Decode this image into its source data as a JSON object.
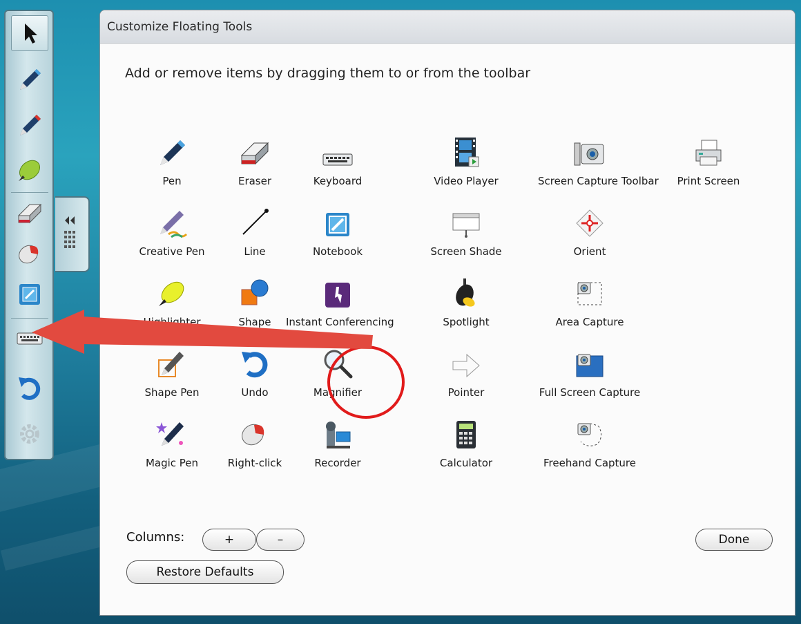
{
  "dialog": {
    "title": "Customize Floating Tools",
    "instructions": "Add or remove items by dragging them to or from the toolbar",
    "columns_label": "Columns:",
    "plus_label": "+",
    "minus_label": "–",
    "restore_label": "Restore Defaults",
    "done_label": "Done"
  },
  "tools": [
    {
      "label": "Pen",
      "icon": "pen-icon"
    },
    {
      "label": "Eraser",
      "icon": "eraser-icon"
    },
    {
      "label": "Keyboard",
      "icon": "keyboard-icon"
    },
    {
      "label": "Video Player",
      "icon": "video-player-icon"
    },
    {
      "label": "Screen Capture Toolbar",
      "icon": "screen-capture-icon"
    },
    {
      "label": "Print Screen",
      "icon": "printer-icon"
    },
    {
      "label": "Creative Pen",
      "icon": "creative-pen-icon"
    },
    {
      "label": "Line",
      "icon": "line-icon"
    },
    {
      "label": "Notebook",
      "icon": "notebook-icon"
    },
    {
      "label": "Screen Shade",
      "icon": "screen-shade-icon"
    },
    {
      "label": "Orient",
      "icon": "orient-icon"
    },
    {
      "label": "Highlighter",
      "icon": "highlighter-icon"
    },
    {
      "label": "Shape",
      "icon": "shape-icon"
    },
    {
      "label": "Instant Conferencing",
      "icon": "conferencing-icon"
    },
    {
      "label": "Spotlight",
      "icon": "spotlight-icon"
    },
    {
      "label": "Area Capture",
      "icon": "area-capture-icon"
    },
    {
      "label": "Shape Pen",
      "icon": "shape-pen-icon"
    },
    {
      "label": "Undo",
      "icon": "undo-icon"
    },
    {
      "label": "Magnifier",
      "icon": "magnifier-icon"
    },
    {
      "label": "Pointer",
      "icon": "pointer-arrow-icon"
    },
    {
      "label": "Full Screen Capture",
      "icon": "full-screen-capture-icon"
    },
    {
      "label": "Magic Pen",
      "icon": "magic-pen-icon"
    },
    {
      "label": "Right-click",
      "icon": "right-click-icon"
    },
    {
      "label": "Recorder",
      "icon": "recorder-icon"
    },
    {
      "label": "Calculator",
      "icon": "calculator-icon"
    },
    {
      "label": "Freehand Capture",
      "icon": "freehand-capture-icon"
    }
  ],
  "toolbar": {
    "items": [
      "select-icon",
      "pen-icon",
      "pen-icon",
      "highlighter-icon",
      "eraser-icon",
      "right-click-icon",
      "notebook-icon",
      "keyboard-icon",
      "undo-icon",
      "settings-gear-icon"
    ],
    "collapse_icon": "collapse-arrows-icon"
  },
  "annotation": {
    "circle_color": "#e11b1b",
    "arrow_color": "#e24a3f"
  }
}
